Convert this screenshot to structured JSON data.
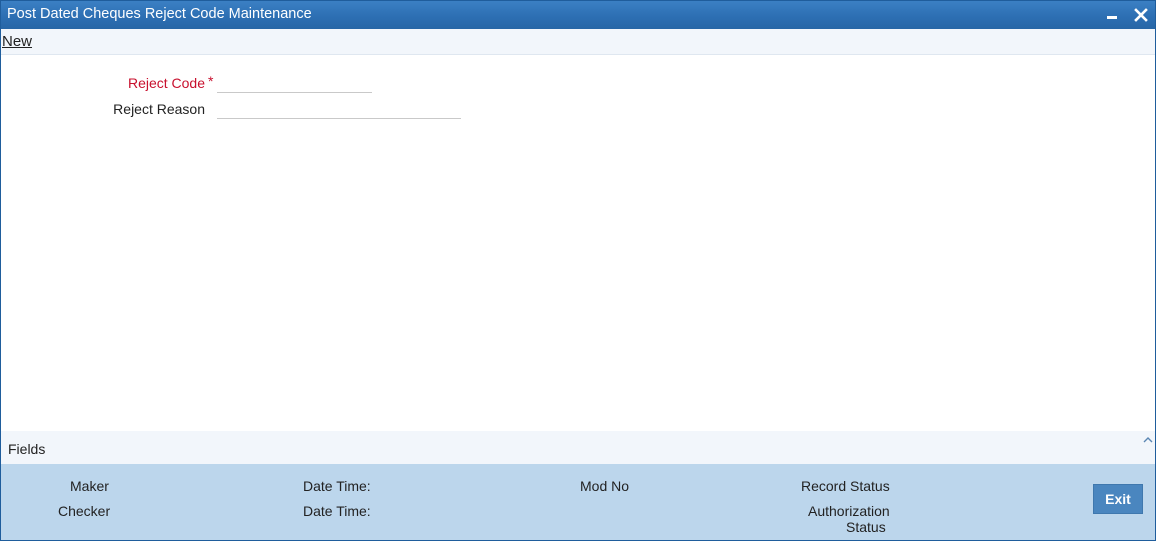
{
  "window": {
    "title": "Post Dated Cheques Reject Code Maintenance",
    "minimize_icon": "minimize-icon",
    "close_icon": "close-icon"
  },
  "menu": {
    "new_label": "New"
  },
  "form": {
    "reject_code": {
      "label": "Reject Code",
      "required_mark": "*",
      "value": ""
    },
    "reject_reason": {
      "label": "Reject Reason",
      "value": ""
    }
  },
  "fields_section": {
    "label": "Fields",
    "toggle_icon": "chevron-up-icon"
  },
  "audit": {
    "maker": "Maker",
    "maker_date_time": "Date Time:",
    "mod_no": "Mod No",
    "record_status": "Record Status",
    "checker": "Checker",
    "checker_date_time": "Date Time:",
    "authorization_status_line1": "Authorization",
    "authorization_status_line2": "Status",
    "exit_label": "Exit"
  },
  "colors": {
    "titlebar": "#2f71b6",
    "required_label": "#c8102e",
    "audit_bg": "#bcd6ec",
    "exit_button": "#4a86bf"
  }
}
